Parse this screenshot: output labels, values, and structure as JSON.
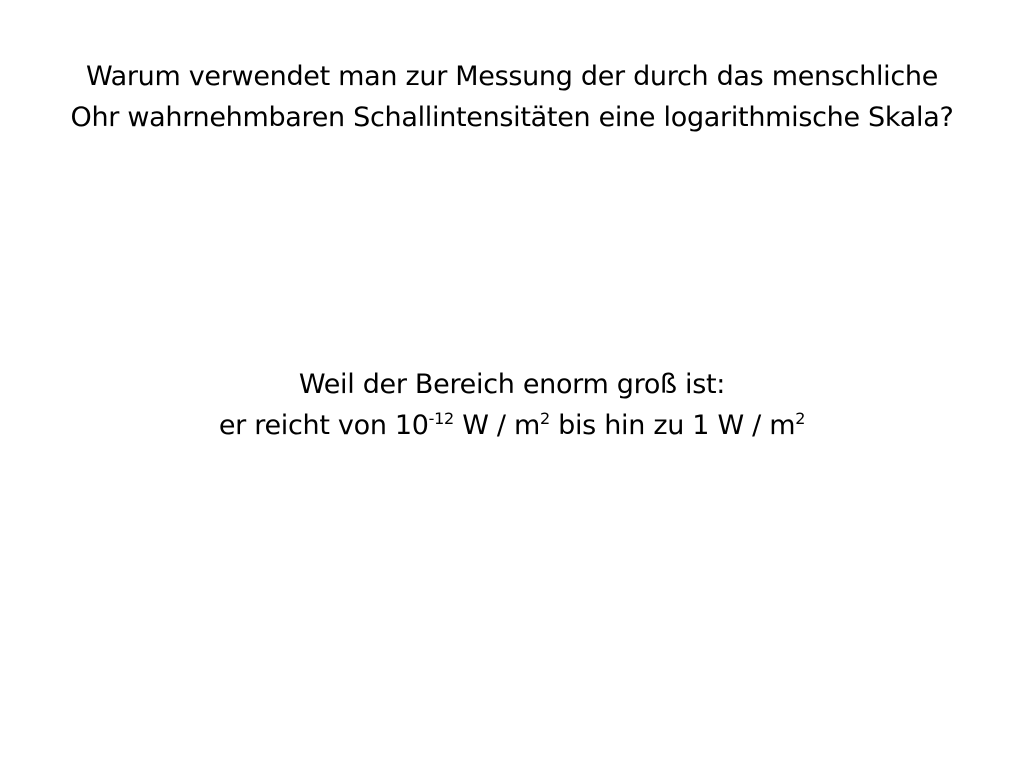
{
  "question": {
    "line1": "Warum verwendet man zur Messung der durch das menschliche",
    "line2": "Ohr wahrnehmbaren Schallintensitäten eine logarithmische Skala?"
  },
  "answer": {
    "line1": "Weil der Bereich enorm groß ist:",
    "line2": {
      "part1": "er reicht von 10",
      "exp1": "-12",
      "part2": " W / m",
      "exp2": "2",
      "part3": " bis hin zu 1 W / m",
      "exp3": "2"
    }
  },
  "colors": {
    "background": "#ffffff",
    "text": "#000000"
  }
}
